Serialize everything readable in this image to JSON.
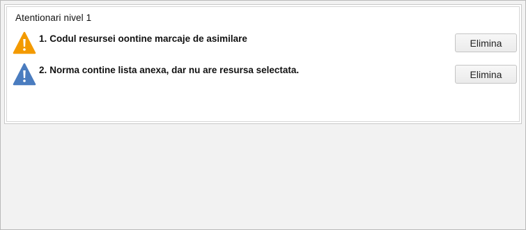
{
  "window": {
    "background": "#f2f2f2"
  },
  "panel": {
    "title": "Atentionari nivel 1"
  },
  "warnings": [
    {
      "number": "1.",
      "text": "Codul resursei oontine marcaje de asimilare",
      "icon": "warning-triangle-orange",
      "icon_color": "#f39a00",
      "button_label": "Elimina"
    },
    {
      "number": "2.",
      "text": "Norma contine lista anexa, dar nu are resursa selectata.",
      "icon": "warning-triangle-blue",
      "icon_color": "#4a7cbf",
      "button_label": "Elimina"
    }
  ]
}
